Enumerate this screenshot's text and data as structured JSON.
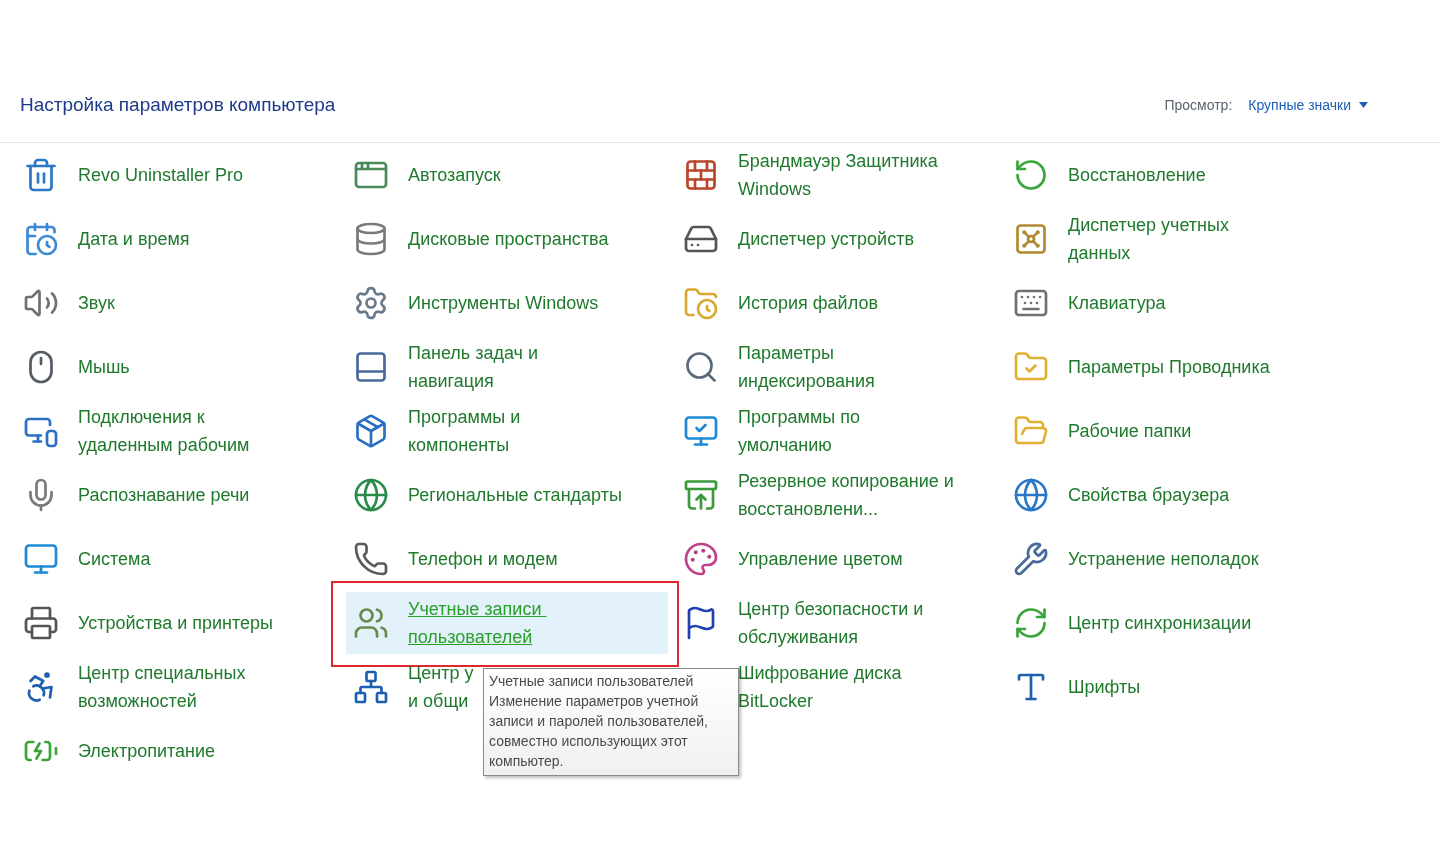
{
  "header": {
    "title": "Настройка параметров компьютера",
    "view_label": "Просмотр:",
    "view_value": "Крупные значки"
  },
  "columns": [
    {
      "items": [
        {
          "label": "Revo Uninstaller Pro",
          "selected": false,
          "annotated": false
        },
        {
          "label": "Дата и время",
          "selected": false,
          "annotated": false
        },
        {
          "label": "Звук",
          "selected": false,
          "annotated": false
        },
        {
          "label": "Мышь",
          "selected": false,
          "annotated": false
        },
        {
          "label": "Подключения к\nудаленным рабочим",
          "selected": false,
          "annotated": false
        },
        {
          "label": "Распознавание речи",
          "selected": false,
          "annotated": false
        },
        {
          "label": "Система",
          "selected": false,
          "annotated": false
        },
        {
          "label": "Устройства и принтеры",
          "selected": false,
          "annotated": false
        },
        {
          "label": "Центр специальных\nвозможностей",
          "selected": false,
          "annotated": false
        },
        {
          "label": "Электропитание",
          "selected": false,
          "annotated": false
        }
      ]
    },
    {
      "items": [
        {
          "label": "Автозапуск",
          "selected": false,
          "annotated": false
        },
        {
          "label": "Дисковые пространства",
          "selected": false,
          "annotated": false
        },
        {
          "label": "Инструменты Windows",
          "selected": false,
          "annotated": false
        },
        {
          "label": "Панель задач и\nнавигация",
          "selected": false,
          "annotated": false
        },
        {
          "label": "Программы и\nкомпоненты",
          "selected": false,
          "annotated": false
        },
        {
          "label": "Региональные стандарты",
          "selected": false,
          "annotated": false
        },
        {
          "label": "Телефон и модем",
          "selected": false,
          "annotated": false
        },
        {
          "label": "Учетные записи \nпользователей",
          "selected": true,
          "annotated": true
        },
        {
          "label": "Центр у\nи общи",
          "selected": false,
          "annotated": false
        }
      ]
    },
    {
      "items": [
        {
          "label": "Брандмауэр Защитника\nWindows",
          "selected": false,
          "annotated": false
        },
        {
          "label": "Диспетчер устройств",
          "selected": false,
          "annotated": false
        },
        {
          "label": "История файлов",
          "selected": false,
          "annotated": false
        },
        {
          "label": "Параметры\nиндексирования",
          "selected": false,
          "annotated": false
        },
        {
          "label": "Программы по\nумолчанию",
          "selected": false,
          "annotated": false
        },
        {
          "label": "Резервное копирование и\nвосстановлени...",
          "selected": false,
          "annotated": false
        },
        {
          "label": "Управление цветом",
          "selected": false,
          "annotated": false
        },
        {
          "label": "Центр безопасности и\nобслуживания",
          "selected": false,
          "annotated": false
        },
        {
          "label": "Шифрование диска\nBitLocker",
          "selected": false,
          "annotated": false
        }
      ]
    },
    {
      "items": [
        {
          "label": "Восстановление",
          "selected": false,
          "annotated": false
        },
        {
          "label": "Диспетчер учетных\nданных",
          "selected": false,
          "annotated": false
        },
        {
          "label": "Клавиатура",
          "selected": false,
          "annotated": false
        },
        {
          "label": "Параметры Проводника",
          "selected": false,
          "annotated": false
        },
        {
          "label": "Рабочие папки",
          "selected": false,
          "annotated": false
        },
        {
          "label": "Свойства браузера",
          "selected": false,
          "annotated": false
        },
        {
          "label": "Устранение неполадок",
          "selected": false,
          "annotated": false
        },
        {
          "label": "Центр синхронизации",
          "selected": false,
          "annotated": false
        },
        {
          "label": "Шрифты",
          "selected": false,
          "annotated": false
        }
      ]
    }
  ],
  "tooltip": {
    "title": "Учетные записи пользователей",
    "text": "Изменение параметров учетной\nзаписи и паролей пользователей,\nсовместно использующих этот\nкомпьютер."
  }
}
